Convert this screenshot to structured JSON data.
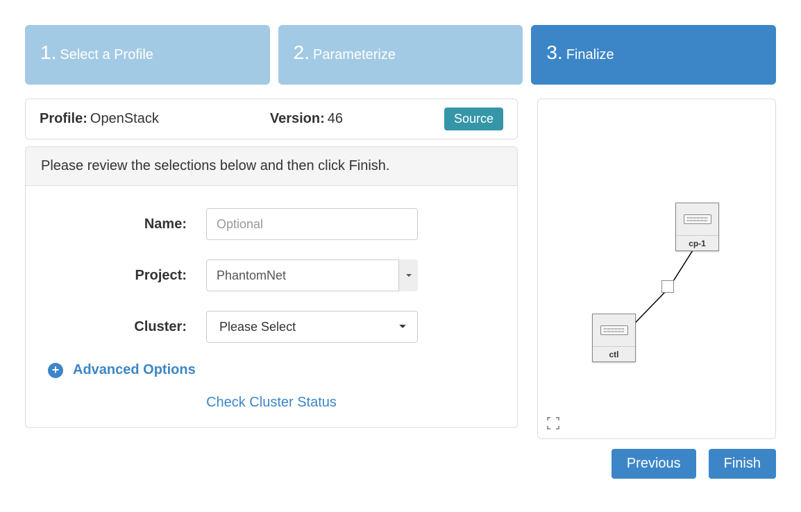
{
  "steps": [
    {
      "num": "1.",
      "label": "Select a Profile"
    },
    {
      "num": "2.",
      "label": "Parameterize"
    },
    {
      "num": "3.",
      "label": "Finalize"
    }
  ],
  "info": {
    "profile_label": "Profile:",
    "profile_value": "OpenStack",
    "version_label": "Version:",
    "version_value": "46",
    "source_btn": "Source"
  },
  "panel": {
    "heading": "Please review the selections below and then click Finish.",
    "name_label": "Name:",
    "name_placeholder": "Optional",
    "name_value": "",
    "project_label": "Project:",
    "project_value": "PhantomNet",
    "cluster_label": "Cluster:",
    "cluster_value": "Please Select",
    "advanced": "Advanced Options",
    "check_status": "Check Cluster Status"
  },
  "topology": {
    "nodes": [
      {
        "id": "cp-1",
        "label": "cp-1"
      },
      {
        "id": "ctl",
        "label": "ctl"
      }
    ]
  },
  "footer": {
    "previous": "Previous",
    "finish": "Finish"
  }
}
